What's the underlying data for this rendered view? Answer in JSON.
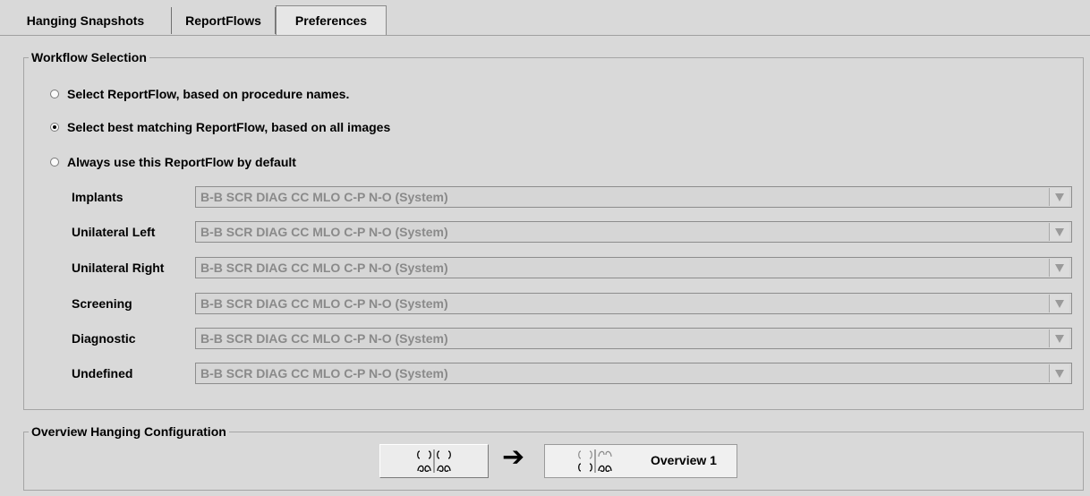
{
  "tabs": [
    {
      "label": "Hanging Snapshots",
      "active": false
    },
    {
      "label": "ReportFlows",
      "active": false
    },
    {
      "label": "Preferences",
      "active": true
    }
  ],
  "workflow_selection": {
    "title": "Workflow Selection",
    "options": [
      {
        "label": "Select ReportFlow, based on procedure names.",
        "checked": false
      },
      {
        "label": "Select best matching ReportFlow, based on all images",
        "checked": true
      },
      {
        "label": "Always use this ReportFlow by default",
        "checked": false
      }
    ],
    "flows": [
      {
        "label": "Implants",
        "value": "B-B SCR DIAG CC MLO C-P N-O (System)"
      },
      {
        "label": "Unilateral Left",
        "value": "B-B SCR DIAG CC MLO C-P N-O (System)"
      },
      {
        "label": "Unilateral Right",
        "value": "B-B SCR DIAG CC MLO C-P N-O (System)"
      },
      {
        "label": "Screening",
        "value": "B-B SCR DIAG CC MLO C-P N-O (System)"
      },
      {
        "label": "Diagnostic",
        "value": "B-B SCR DIAG CC MLO C-P N-O (System)"
      },
      {
        "label": "Undefined",
        "value": "B-B SCR DIAG CC MLO C-P N-O (System)"
      }
    ]
  },
  "overview_hanging": {
    "title": "Overview Hanging Configuration",
    "source_icon": "hanging-layout-icon",
    "arrow_icon": "right-arrow-icon",
    "target_label": "Overview 1"
  },
  "colors": {
    "background": "#d9d9d9",
    "disabled_text": "#8a8a8a"
  }
}
